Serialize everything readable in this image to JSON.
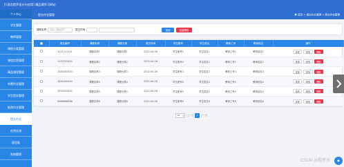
{
  "app": {
    "title": "[C语言程序设计与应用] 精品课学习网站"
  },
  "sidebar": {
    "head": "个人中心",
    "items": [
      {
        "label": "学生管理"
      },
      {
        "label": "教师管理"
      },
      {
        "label": "课程分类管理"
      },
      {
        "label": "课程信息管理"
      },
      {
        "label": "精品课程管理"
      },
      {
        "label": "布置作业管理"
      },
      {
        "label": "学生提交管理"
      },
      {
        "label": "批改作业管理"
      },
      {
        "label": "提交作业"
      },
      {
        "label": "在线交流"
      },
      {
        "label": "留言板"
      },
      {
        "label": "系统管理"
      }
    ]
  },
  "page": {
    "title": "提交作业管理",
    "breadcrumb": "首页 > 提交作业管理 > 提交作业管理"
  },
  "search": {
    "field1_label": "课程名称",
    "field1_placeholder": "请输入课程名称",
    "field2_label": "提交时间",
    "field2_placeholder": "",
    "search_button": "查询",
    "bulk_delete_button": "批量删除"
  },
  "table": {
    "columns": [
      "",
      "提交编号",
      "课程名称",
      "课程分类",
      "提交时间",
      "学生账号",
      "学生姓名",
      "教师工号",
      "教师姓名",
      "操作"
    ],
    "rows": [
      {
        "no": "1111111111",
        "course": "课程名称1",
        "category": "课程分类1",
        "time": "2022-04-28",
        "stuacct": "学生账号1",
        "stuname": "学生姓名1",
        "tno": "教师工号1",
        "tname": "教师姓名1"
      },
      {
        "no": "2222222222",
        "course": "课程名称2",
        "category": "课程分类2",
        "time": "2022-04-28",
        "stuacct": "学生账号2",
        "stuname": "学生姓名2",
        "tno": "教师工号2",
        "tname": "教师姓名2"
      },
      {
        "no": "3333333333",
        "course": "课程名称3",
        "category": "课程分类3",
        "time": "2022-04-28",
        "stuacct": "学生账号3",
        "stuname": "学生姓名3",
        "tno": "教师工号3",
        "tname": "教师姓名3"
      },
      {
        "no": "4444444444",
        "course": "课程名称4",
        "category": "课程分类4",
        "time": "2022-04-28",
        "stuacct": "学生账号4",
        "stuname": "学生姓名4",
        "tno": "教师工号4",
        "tname": "教师姓名4"
      },
      {
        "no": "5555555555",
        "course": "课程名称5",
        "category": "课程分类5",
        "time": "2022-04-28",
        "stuacct": "学生账号5",
        "stuname": "学生姓名5",
        "tno": "教师工号5",
        "tname": "教师姓名5"
      },
      {
        "no": "6666666666",
        "course": "课程名称6",
        "category": "课程分类6",
        "time": "2022-04-28",
        "stuacct": "学生账号6",
        "stuname": "学生姓名6",
        "tno": "教师工号6",
        "tname": "教师姓名6"
      }
    ],
    "edit_label": "修改",
    "view_label": "查看",
    "delete_label": "删除"
  },
  "pager": {
    "page_size": "10",
    "prev": "上一页",
    "current": "1",
    "next": "下一页"
  },
  "watermark": "CSDN @程序员",
  "colors": {
    "primary": "#2a86e6",
    "header": "#2f6fd3",
    "danger": "#e8354b"
  }
}
